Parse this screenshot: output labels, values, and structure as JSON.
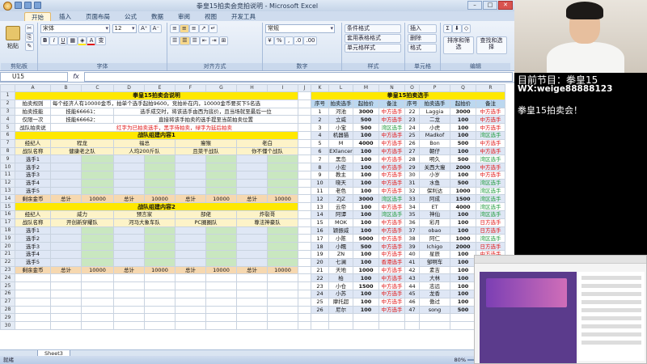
{
  "window": {
    "title": "拳皇15拍卖会竞拍说明 - Microsoft Excel"
  },
  "tabs": [
    "开始",
    "插入",
    "页面布局",
    "公式",
    "数据",
    "审阅",
    "视图",
    "开发工具"
  ],
  "ribbon": {
    "clipboard": {
      "label": "剪贴板",
      "paste": "粘贴"
    },
    "font": {
      "label": "字体",
      "name": "宋体",
      "size": "12"
    },
    "align": {
      "label": "对齐方式"
    },
    "number": {
      "label": "数字",
      "format": "常规"
    },
    "styles": {
      "label": "样式",
      "items": [
        "条件格式",
        "套用表格格式",
        "单元格样式"
      ]
    },
    "cells": {
      "label": "单元格",
      "items": [
        "插入",
        "删除",
        "格式"
      ]
    },
    "editing": {
      "label": "编辑",
      "items": [
        "排序和筛选",
        "查找和选择"
      ]
    }
  },
  "namebox": "U15",
  "columns": [
    "A",
    "B",
    "C",
    "D",
    "E",
    "F",
    "G",
    "H",
    "I",
    "J",
    "K",
    "L",
    "M",
    "N",
    "O",
    "P",
    "Q",
    "R"
  ],
  "left": {
    "title": "拳皇15拍卖会说明",
    "rules": [
      [
        "拍卖规则",
        "每个经济人有10000金币，拍单个选手起拍9600，竞拍补在内，10000金币要买下5名选"
      ],
      [
        "拍卖技能",
        "技能66661：",
        "选手成交时，将该选手由西为底价，且当场就至最后一位"
      ],
      [
        "仅限一次",
        "技能66662：",
        "直接将该手拍卖的选手提至当前拍卖位置"
      ],
      [
        "战队拍卖说",
        "红字为已拍卖选手，黑字待拍卖，绿字为延后拍卖"
      ]
    ],
    "section1": "战队组建内容1",
    "section2": "战队组建内容2",
    "labels": {
      "manager": "经纪人",
      "team": "战队名称",
      "remain": "剩余金币",
      "total": "总计",
      "p1": "选手1",
      "p2": "选手2",
      "p3": "选手3",
      "p4": "选手4",
      "p5": "选手5",
      "money": "10000"
    },
    "managers1": [
      "程龙",
      "福总",
      "瘦猴",
      "老白"
    ],
    "teams1": [
      "健康老之队",
      "人均200斤队",
      "且菜干战队",
      "你不懂个战队"
    ],
    "managers2": [
      "威力",
      "预言家",
      "部佬",
      "炸裂哥"
    ],
    "teams2": [
      "开创新穿耀队",
      "河马大象车队",
      "PC圈圈队",
      "尊法神豪队"
    ]
  },
  "right": {
    "title": "拳皇15拍卖选手",
    "headers": [
      "序号",
      "拍卖选手",
      "起拍价",
      "备注"
    ],
    "status": {
      "cn": "中方选手",
      "tw": "湾区选手",
      "jp": "日方选手",
      "hk": "香港选手"
    },
    "players_a": [
      [
        1,
        "河池",
        "3000",
        "cn"
      ],
      [
        2,
        "立威",
        "500",
        "cn"
      ],
      [
        3,
        "小宝",
        "500",
        "tw"
      ],
      [
        4,
        "机器猫",
        "100",
        "cn"
      ],
      [
        5,
        "M",
        "4000",
        "cn"
      ],
      [
        6,
        "EXlancer",
        "100",
        "cn"
      ],
      [
        7,
        "黑岛",
        "100",
        "cn"
      ],
      [
        8,
        "小宏",
        "100",
        "cn"
      ],
      [
        9,
        "教主",
        "100",
        "cn"
      ],
      [
        10,
        "晓天",
        "100",
        "cn"
      ],
      [
        11,
        "老色",
        "100",
        "cn"
      ],
      [
        12,
        "ZJZ",
        "3000",
        "tw"
      ],
      [
        13,
        "云帝",
        "100",
        "cn"
      ],
      [
        14,
        "阿谭",
        "100",
        "tw"
      ],
      [
        15,
        "MOK",
        "100",
        "cn"
      ],
      [
        16,
        "颖振威",
        "100",
        "cn"
      ],
      [
        17,
        "小陈",
        "5000",
        "cn"
      ],
      [
        18,
        "小糯",
        "500",
        "cn"
      ],
      [
        19,
        "ZN",
        "100",
        "cn"
      ],
      [
        20,
        "七澜",
        "100",
        "hk"
      ],
      [
        21,
        "天地",
        "1000",
        "cn"
      ],
      [
        22,
        "柏",
        "100",
        "cn"
      ],
      [
        23,
        "小仓",
        "1500",
        "cn"
      ],
      [
        24,
        "小苏",
        "100",
        "cn"
      ],
      [
        25,
        "摩托超",
        "100",
        "cn"
      ],
      [
        26,
        "尼尔",
        "100",
        "cn"
      ]
    ],
    "players_b": [
      [
        22,
        "Laggia",
        "3000",
        "cn"
      ],
      [
        23,
        "二龙",
        "100",
        "cn"
      ],
      [
        24,
        "小虎",
        "100",
        "cn"
      ],
      [
        25,
        "Madkof",
        "100",
        "tw"
      ],
      [
        26,
        "Bon",
        "500",
        "cn"
      ],
      [
        27,
        "朝仔",
        "100",
        "cn"
      ],
      [
        28,
        "明久",
        "500",
        "tw"
      ],
      [
        29,
        "关西大瘦",
        "2000",
        "cn"
      ],
      [
        30,
        "小岁",
        "100",
        "cn"
      ],
      [
        31,
        "水鱼",
        "500",
        "tw"
      ],
      [
        32,
        "保利达",
        "1000",
        "tw"
      ],
      [
        33,
        "阿成",
        "1500",
        "tw"
      ],
      [
        34,
        "ET",
        "4000",
        "tw"
      ],
      [
        35,
        "神仙",
        "100",
        "tw"
      ],
      [
        36,
        "彩月",
        "100",
        "jp"
      ],
      [
        37,
        "obao",
        "100",
        "jp"
      ],
      [
        38,
        "阿仁",
        "1000",
        "tw"
      ],
      [
        39,
        "Ichigo",
        "2000",
        "jp"
      ],
      [
        40,
        "星辰",
        "100",
        "cn"
      ],
      [
        41,
        "邹啊车",
        "100",
        "cn"
      ],
      [
        42,
        "素吉",
        "100",
        "cn"
      ],
      [
        43,
        "大林",
        "100",
        "cn"
      ],
      [
        44,
        "志远",
        "100",
        "cn"
      ],
      [
        45,
        "龙香",
        "100",
        "cn"
      ],
      [
        46,
        "傲过",
        "100",
        "cn"
      ],
      [
        47,
        "song",
        "500",
        "cn"
      ]
    ]
  },
  "sheet_tab": "Sheet3",
  "status": {
    "ready": "就绪",
    "zoom": "80%"
  },
  "overlay": {
    "line1": "目前节目：拳皇15",
    "line2": "WX:weige88888123",
    "line3": "拳皇15拍卖会！"
  },
  "colors": {
    "yellow": "#ffe800",
    "red": "#e01515",
    "green": "#1c9a3a",
    "header": "#bcd8ef"
  }
}
